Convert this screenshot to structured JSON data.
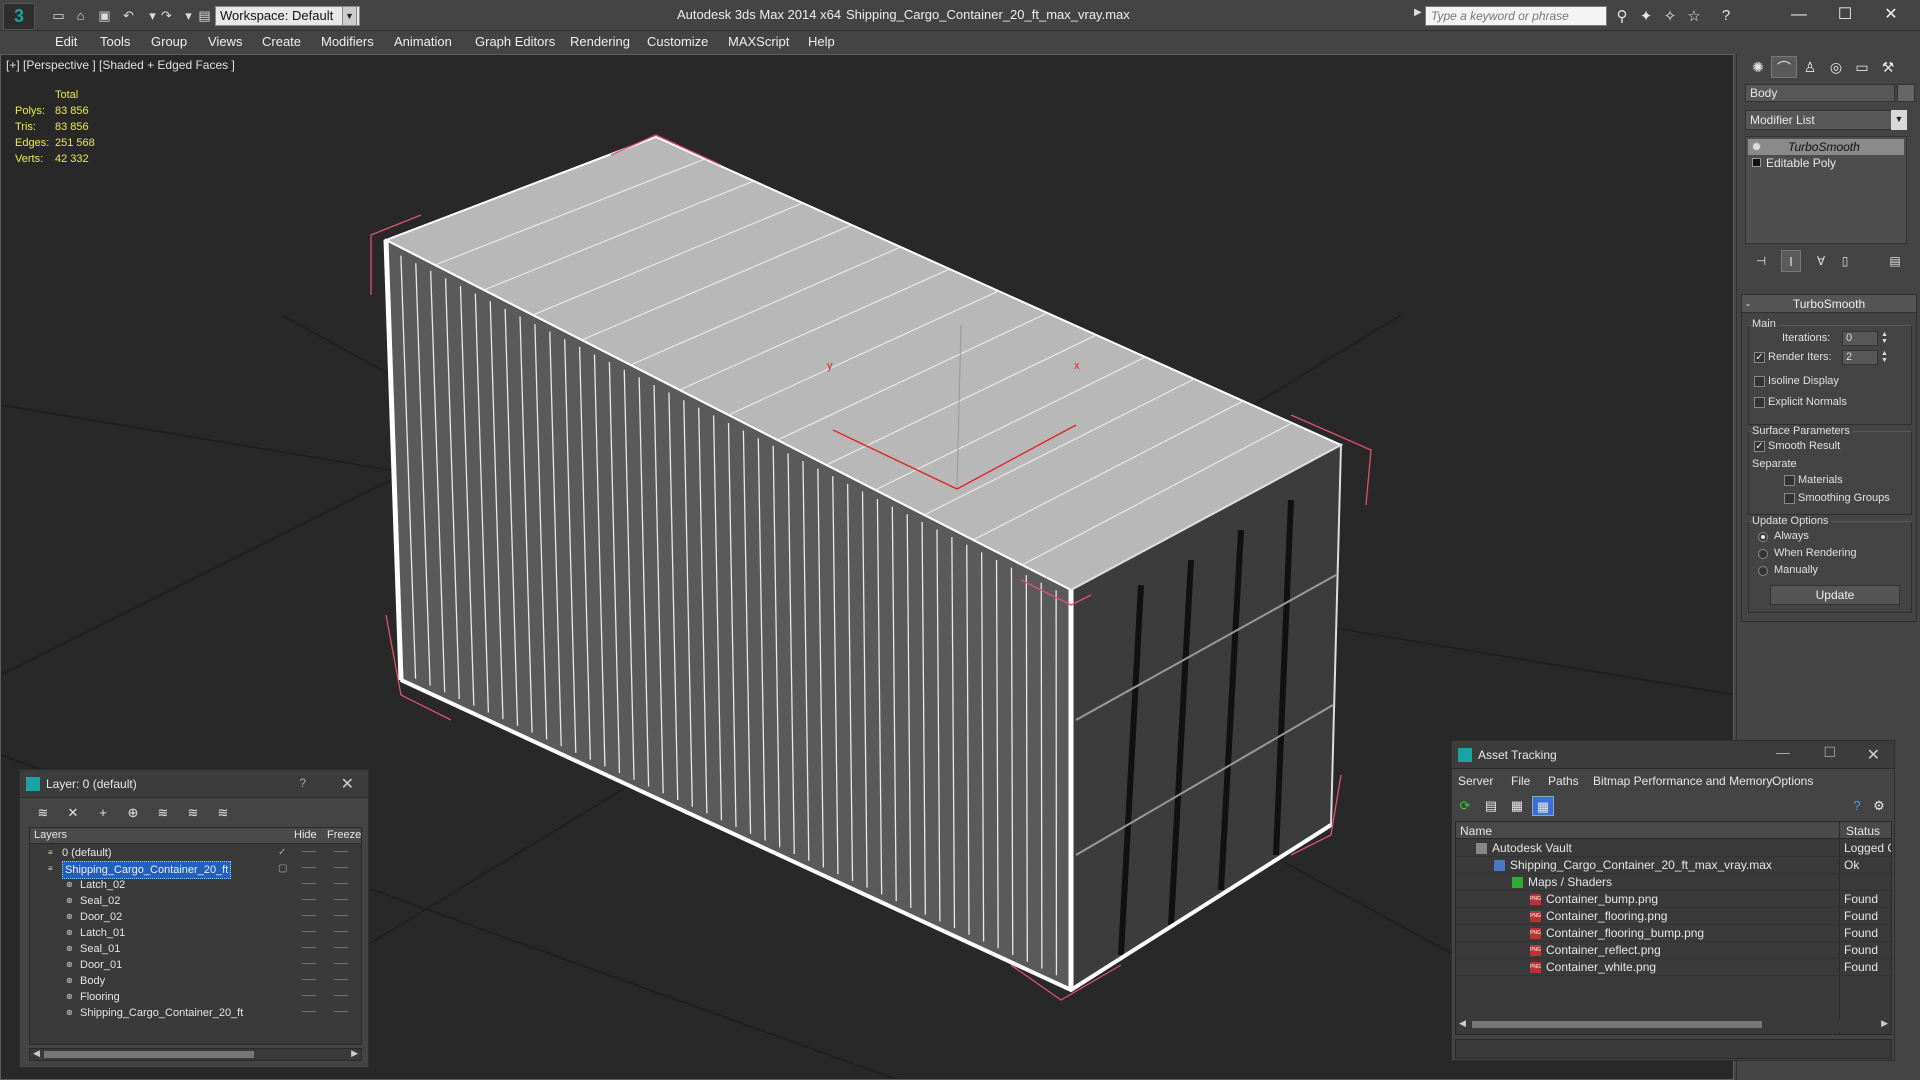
{
  "window": {
    "app_title": "Autodesk 3ds Max  2014 x64",
    "file_title": "Shipping_Cargo_Container_20_ft_max_vray.max",
    "workspace": "Workspace: Default",
    "search_placeholder": "Type a keyword or phrase",
    "minimize": "—",
    "maximize": "☐",
    "close": "✕"
  },
  "menu": [
    "Edit",
    "Tools",
    "Group",
    "Views",
    "Create",
    "Modifiers",
    "Animation",
    "Graph Editors",
    "Rendering",
    "Customize",
    "MAXScript",
    "Help"
  ],
  "viewport": {
    "label": "[+] [Perspective ] [Shaded + Edged Faces ]",
    "stats_header": "Total",
    "stats": [
      {
        "k": "Polys:",
        "v": "83 856"
      },
      {
        "k": "Tris:",
        "v": "83 856"
      },
      {
        "k": "Edges:",
        "v": "251 568"
      },
      {
        "k": "Verts:",
        "v": "42 332"
      }
    ],
    "axis_x": "x",
    "axis_y": "y"
  },
  "command_panel": {
    "object_name": "Body",
    "modifier_list": "Modifier List",
    "stack": [
      "TurboSmooth",
      "Editable Poly"
    ],
    "rollout_title": "TurboSmooth",
    "main_label": "Main",
    "iterations_label": "Iterations:",
    "iterations_value": "0",
    "render_iters_label": "Render Iters:",
    "render_iters_value": "2",
    "isoline_label": "Isoline Display",
    "explicit_normals_label": "Explicit Normals",
    "surface_params_label": "Surface Parameters",
    "smooth_result_label": "Smooth Result",
    "separate_label": "Separate",
    "materials_label": "Materials",
    "smoothing_groups_label": "Smoothing Groups",
    "update_options_label": "Update Options",
    "always_label": "Always",
    "when_rendering_label": "When Rendering",
    "manually_label": "Manually",
    "update_button": "Update"
  },
  "layer_dialog": {
    "title": "Layer: 0 (default)",
    "help": "?",
    "close": "✕",
    "columns": [
      "Layers",
      "Hide",
      "Freeze"
    ],
    "rows": [
      {
        "name": "0 (default)",
        "indent": 0,
        "selected": false
      },
      {
        "name": "Shipping_Cargo_Container_20_ft",
        "indent": 0,
        "selected": true
      },
      {
        "name": "Latch_02",
        "indent": 1,
        "selected": false
      },
      {
        "name": "Seal_02",
        "indent": 1,
        "selected": false
      },
      {
        "name": "Door_02",
        "indent": 1,
        "selected": false
      },
      {
        "name": "Latch_01",
        "indent": 1,
        "selected": false
      },
      {
        "name": "Seal_01",
        "indent": 1,
        "selected": false
      },
      {
        "name": "Door_01",
        "indent": 1,
        "selected": false
      },
      {
        "name": "Body",
        "indent": 1,
        "selected": false
      },
      {
        "name": "Flooring",
        "indent": 1,
        "selected": false
      },
      {
        "name": "Shipping_Cargo_Container_20_ft",
        "indent": 1,
        "selected": false
      }
    ]
  },
  "asset_dialog": {
    "title": "Asset Tracking",
    "menu": [
      "Server",
      "File",
      "Paths",
      "Bitmap Performance and Memory",
      "Options"
    ],
    "columns": [
      "Name",
      "Status"
    ],
    "rows": [
      {
        "name": "Autodesk Vault",
        "status": "Logged O",
        "indent": 0
      },
      {
        "name": "Shipping_Cargo_Container_20_ft_max_vray.max",
        "status": "Ok",
        "indent": 1
      },
      {
        "name": "Maps / Shaders",
        "status": "",
        "indent": 2
      },
      {
        "name": "Container_bump.png",
        "status": "Found",
        "indent": 3
      },
      {
        "name": "Container_flooring.png",
        "status": "Found",
        "indent": 3
      },
      {
        "name": "Container_flooring_bump.png",
        "status": "Found",
        "indent": 3
      },
      {
        "name": "Container_reflect.png",
        "status": "Found",
        "indent": 3
      },
      {
        "name": "Container_white.png",
        "status": "Found",
        "indent": 3
      }
    ]
  },
  "colors": {
    "accent": "#1aa3a3",
    "stats_text": "#e8e858",
    "selection": "#1f5fbf",
    "wire": "#ffffff",
    "bbox": "#e05070"
  }
}
